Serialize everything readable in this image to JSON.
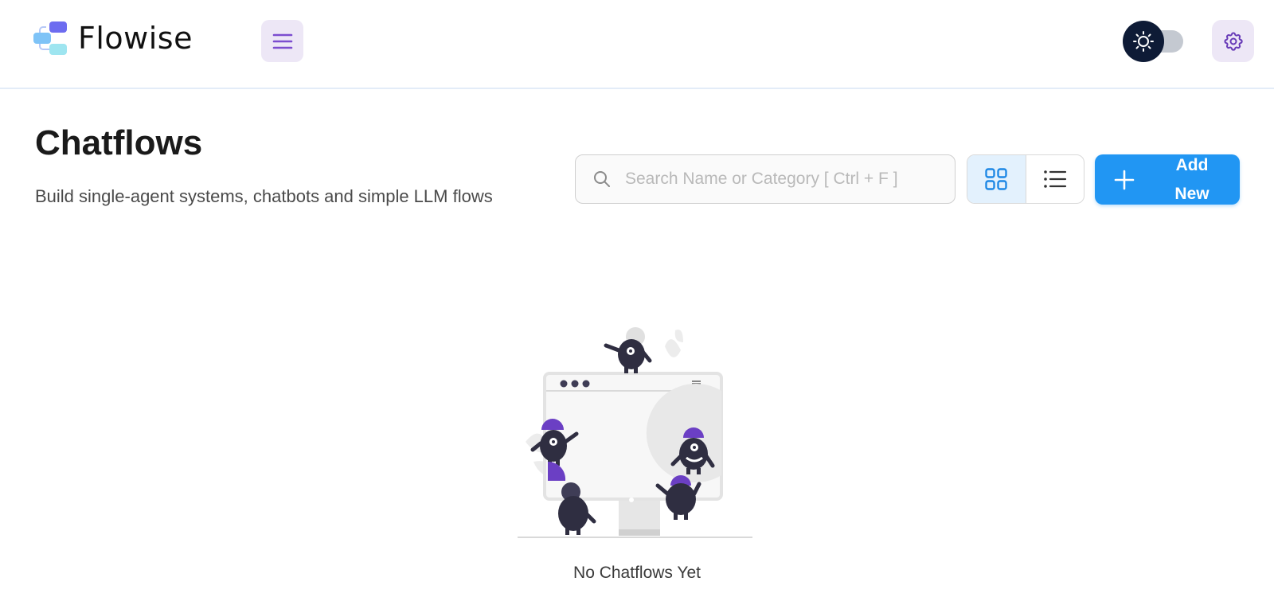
{
  "app": {
    "name": "Flowise"
  },
  "header": {
    "menu_icon": "hamburger-menu-icon",
    "theme_icon": "sun-icon",
    "settings_icon": "gear-icon"
  },
  "page": {
    "title": "Chatflows",
    "subtitle": "Build single-agent systems, chatbots and simple LLM flows"
  },
  "search": {
    "placeholder": "Search Name or Category [ Ctrl + F ]",
    "value": ""
  },
  "view_toggle": {
    "selected": "card",
    "options": [
      "card",
      "list"
    ]
  },
  "add_button": {
    "label": "Add New"
  },
  "empty_state": {
    "message": "No Chatflows Yet"
  },
  "colors": {
    "primary": "#2196f3",
    "secondary_light": "#ede7f6",
    "secondary": "#673ab7",
    "illustration_purple": "#6b3fc4",
    "illustration_dark": "#2f2e41"
  }
}
